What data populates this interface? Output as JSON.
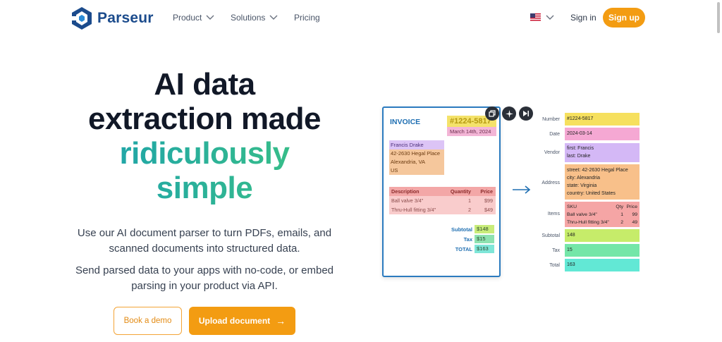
{
  "nav": {
    "brand": "Parseur",
    "items": [
      {
        "label": "Product"
      },
      {
        "label": "Solutions"
      },
      {
        "label": "Pricing"
      }
    ],
    "signin": "Sign in",
    "signup": "Sign up"
  },
  "hero": {
    "title_line1": "AI data",
    "title_line2": "extraction made",
    "title_line3": "ridiculously",
    "title_line4": "simple",
    "subtitle1": "Use our AI document parser to turn PDFs, emails, and scanned documents into structured data.",
    "subtitle2": "Send parsed data to your apps with no-code, or embed parsing in your product via API.",
    "btn_demo": "Book a demo",
    "btn_upload": "Upload document",
    "btn_upload_arrow": "→"
  },
  "invoice": {
    "title": "INVOICE",
    "number": "#1224-5817",
    "date": "March 14th, 2024",
    "name": "Francis Drake",
    "address": [
      "42-2630 Hegal Place",
      "Alexandria, VA",
      "US"
    ],
    "table": {
      "headers": [
        "Description",
        "Quantity",
        "Price"
      ],
      "rows": [
        [
          "Ball valve 3/4\"",
          "1",
          "$99"
        ],
        [
          "Thru-Hull fitting 3/4\"",
          "2",
          "$49"
        ]
      ]
    },
    "subtotal_label": "Subtotal",
    "subtotal": "$148",
    "tax_label": "Tax",
    "tax": "$15",
    "total_label": "TOTAL",
    "total": "$163"
  },
  "output": {
    "number_label": "Number",
    "number": "#1224-5817",
    "date_label": "Date",
    "date": "2024-03-14",
    "vendor_label": "Vendor",
    "vendor_first": "first: Francis",
    "vendor_last": "last: Drake",
    "address_label": "Address",
    "address_street": "street: 42-2630 Hegal Place",
    "address_city": "city: Alexandria",
    "address_state": "state: Virginia",
    "address_country": "country: United States",
    "items_label": "Items",
    "items_headers": [
      "SKU",
      "Qty",
      "Price"
    ],
    "items_rows": [
      [
        "Ball valve 3/4\"",
        "1",
        "99"
      ],
      [
        "Thru-Hull fitting 3/4\"",
        "2",
        "49"
      ]
    ],
    "subtotal_label": "Subtotal",
    "subtotal": "148",
    "tax_label": "Tax",
    "tax": "15",
    "total_label": "Total",
    "total": "163"
  },
  "colors": {
    "accent": "#f39c12",
    "brand": "#1b4b8c",
    "gradient_start": "#1a9fb0",
    "gradient_end": "#3dc480"
  },
  "icons": [
    "parseur-logo-icon",
    "chevron-down-icon",
    "us-flag-icon",
    "copy-icon",
    "sparkle-icon",
    "skip-icon",
    "arrow-right-icon"
  ]
}
